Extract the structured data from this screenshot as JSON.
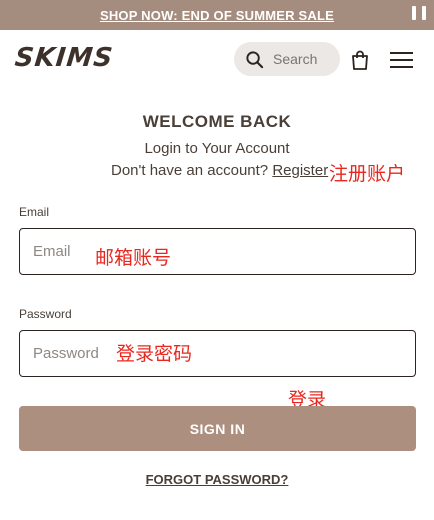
{
  "banner": {
    "text": "SHOP NOW: END OF SUMMER SALE"
  },
  "header": {
    "logo": "SKIMS",
    "search_label": "Search"
  },
  "login": {
    "heading": "WELCOME BACK",
    "subheading": "Login to Your Account",
    "no_account_prefix": "Don't have an account?",
    "register_link": "Register"
  },
  "form": {
    "email_label": "Email",
    "email_placeholder": "Email",
    "password_label": "Password",
    "password_placeholder": "Password",
    "submit_label": "SIGN IN",
    "forgot_label": "FORGOT PASSWORD?"
  },
  "annotations": {
    "register": "注册账户",
    "email": "邮箱账号",
    "password": "登录密码",
    "signin": "登录"
  },
  "colors": {
    "banner_bg": "#a48d7f",
    "button_bg": "#ad8f80",
    "annotation_red": "#e8281f",
    "text_dark": "#4a3f38"
  },
  "icons": [
    "pause-icon",
    "search-icon",
    "shopping-bag-icon",
    "hamburger-menu-icon"
  ]
}
